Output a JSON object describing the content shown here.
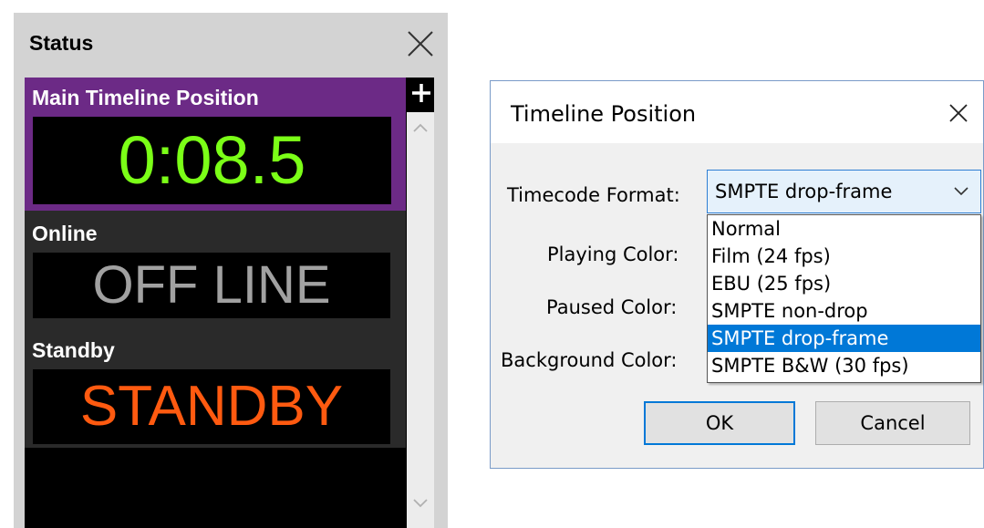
{
  "status_panel": {
    "title": "Status",
    "widgets": [
      {
        "label": "Main Timeline Position",
        "value": "0:08.5",
        "color": "#7bff17"
      },
      {
        "label": "Online",
        "value": "OFF LINE",
        "color": "#a1a1a1"
      },
      {
        "label": "Standby",
        "value": "STANDBY",
        "color": "#ff5a10"
      }
    ],
    "icons": {
      "close": "close-icon",
      "add": "plus-icon",
      "scroll_up": "chevron-up-icon",
      "scroll_down": "chevron-down-icon"
    },
    "accent_color": "#6c2a86"
  },
  "dialog": {
    "title": "Timeline Position",
    "timecode_format_label": "Timecode Format:",
    "timecode_format_value": "SMPTE drop-frame",
    "playing_color_label": "Playing Color:",
    "paused_color_label": "Paused Color:",
    "background_color_label": "Background Color:",
    "dropdown_options": [
      "Normal",
      "Film (24 fps)",
      "EBU (25 fps)",
      "SMPTE non-drop",
      "SMPTE drop-frame",
      "SMPTE B&W (30 fps)"
    ],
    "selected_option_index": 4,
    "ok_label": "OK",
    "cancel_label": "Cancel",
    "selection_color": "#0078d7"
  }
}
